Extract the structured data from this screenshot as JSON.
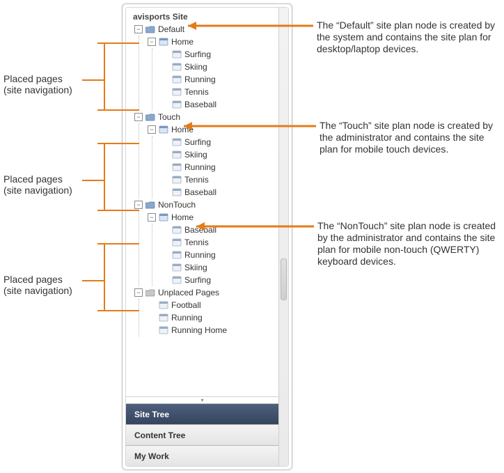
{
  "site_title": "avisports Site",
  "colors": {
    "accent": "#e47b1a"
  },
  "tree": {
    "default": {
      "label": "Default",
      "home": "Home",
      "pages": [
        "Surfing",
        "Skiing",
        "Running",
        "Tennis",
        "Baseball"
      ]
    },
    "touch": {
      "label": "Touch",
      "home": "Home",
      "pages": [
        "Surfing",
        "Skiing",
        "Running",
        "Tennis",
        "Baseball"
      ]
    },
    "nontouch": {
      "label": "NonTouch",
      "home": "Home",
      "pages": [
        "Baseball",
        "Tennis",
        "Running",
        "Skiing",
        "Surfing"
      ]
    },
    "unplaced": {
      "label": "Unplaced Pages",
      "pages": [
        "Football",
        "Running",
        "Running Home"
      ]
    }
  },
  "tabs": {
    "site_tree": "Site Tree",
    "content_tree": "Content Tree",
    "my_work": "My Work"
  },
  "annotations": {
    "left_label_line1": "Placed pages",
    "left_label_line2": "(site navigation)",
    "right_default": "The “Default” site plan node is created by the system and contains the site plan for desktop/laptop devices.",
    "right_touch": "The “Touch” site plan node is created by the administrator and contains the site plan for mobile touch devices.",
    "right_nontouch": "The “NonTouch” site plan node is created by the administrator and contains the site plan for mobile non-touch (QWERTY) keyboard devices."
  }
}
